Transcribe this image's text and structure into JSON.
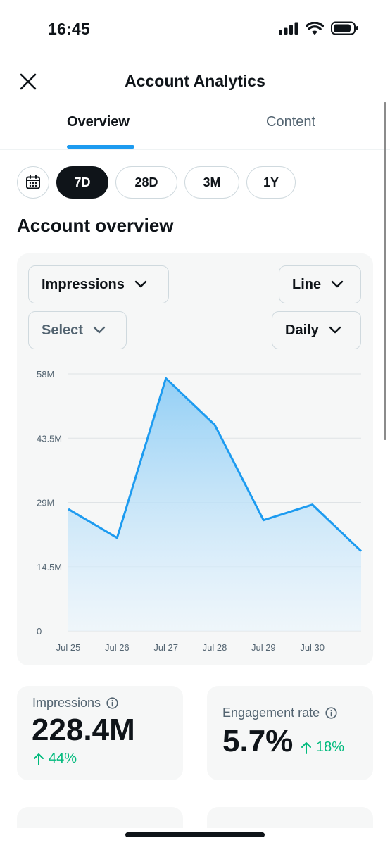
{
  "status_bar": {
    "time": "16:45"
  },
  "header": {
    "title": "Account Analytics"
  },
  "tabs": [
    {
      "label": "Overview",
      "active": true
    },
    {
      "label": "Content",
      "active": false
    }
  ],
  "ranges": [
    {
      "label": "7D",
      "active": true
    },
    {
      "label": "28D",
      "active": false
    },
    {
      "label": "3M",
      "active": false
    },
    {
      "label": "1Y",
      "active": false
    }
  ],
  "section_title": "Account overview",
  "controls": {
    "metric": "Impressions",
    "compare_placeholder": "Select",
    "chart_type": "Line",
    "interval": "Daily"
  },
  "chart_data": {
    "type": "area",
    "categories": [
      "Jul 25",
      "Jul 26",
      "Jul 27",
      "Jul 28",
      "Jul 29",
      "Jul 30",
      ""
    ],
    "values": [
      27.5,
      21,
      57,
      46.5,
      25,
      28.5,
      18
    ],
    "yticks": [
      0,
      14.5,
      29,
      43.5,
      58
    ],
    "ytick_labels": [
      "0",
      "14.5M",
      "29M",
      "43.5M",
      "58M"
    ],
    "ylim": [
      0,
      58
    ],
    "grid": true,
    "colors": {
      "line": "#1d9bf0",
      "fill_top": "#8ecdf5",
      "fill_bottom": "#eaf5fd"
    }
  },
  "stats": [
    {
      "label": "Impressions",
      "value": "228.4M",
      "change": "44%"
    },
    {
      "label": "Engagement rate",
      "value": "5.7%",
      "change": "18%"
    }
  ],
  "colors": {
    "accent": "#1d9bf0",
    "positive": "#00ba7c",
    "text": "#0f1419",
    "muted": "#536471"
  }
}
